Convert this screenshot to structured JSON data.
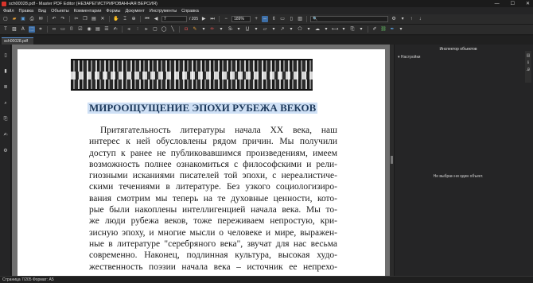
{
  "window": {
    "title": "sch00028.pdf - Master PDF Editor (НЕЗАРЕГИСТРИРОВАННАЯ ВЕРСИЯ)",
    "minimize": "—",
    "maximize": "☐",
    "close": "✕"
  },
  "menu": [
    "Файл",
    "Правка",
    "Вид",
    "Объекты",
    "Комментарии",
    "Формы",
    "Документ",
    "Инструменты",
    "Справка"
  ],
  "toolbar": {
    "page_current": "7",
    "page_total": "/ 205",
    "zoom": "189%",
    "search_placeholder": ""
  },
  "tab": {
    "label": "sch00028.pdf"
  },
  "document": {
    "heading": "МИРООЩУЩЕНИЕ ЭПОХИ РУБЕЖА ВЕКОВ",
    "lines": [
      "Притягательность литературы начала XX века, наш",
      "интерес к ней обусловлены рядом причин. Мы получили",
      "доступ к ранее не публиковавшимся произведениям, имеем",
      "возможность полнее ознакомиться с философскими и рели-",
      "гиозными исканиями писателей той эпохи, с нереалистиче-",
      "скими течениями в литературе. Без узкого социологизиро-",
      "вания смотрим мы теперь на те духовные ценности, кото-",
      "рые были накоплены интеллигенцией начала века. Мы то-",
      "же люди рубежа веков, тоже переживаем непростую, кри-",
      "зисную эпоху, и многие мысли о человеке и мире, выражен-",
      "ные в литературе \"серебряного века\", звучат для нас весьма",
      "современно. Наконец, подлинная культура, высокая худо-",
      "жественность поэзии начала века – источник ее непрехо-"
    ]
  },
  "inspector": {
    "title": "Инспектор объектов",
    "group": "Настройки",
    "empty_message": "Не выбран ни один объект."
  },
  "status": {
    "text": "Страница 7/205 Формат: A5"
  }
}
